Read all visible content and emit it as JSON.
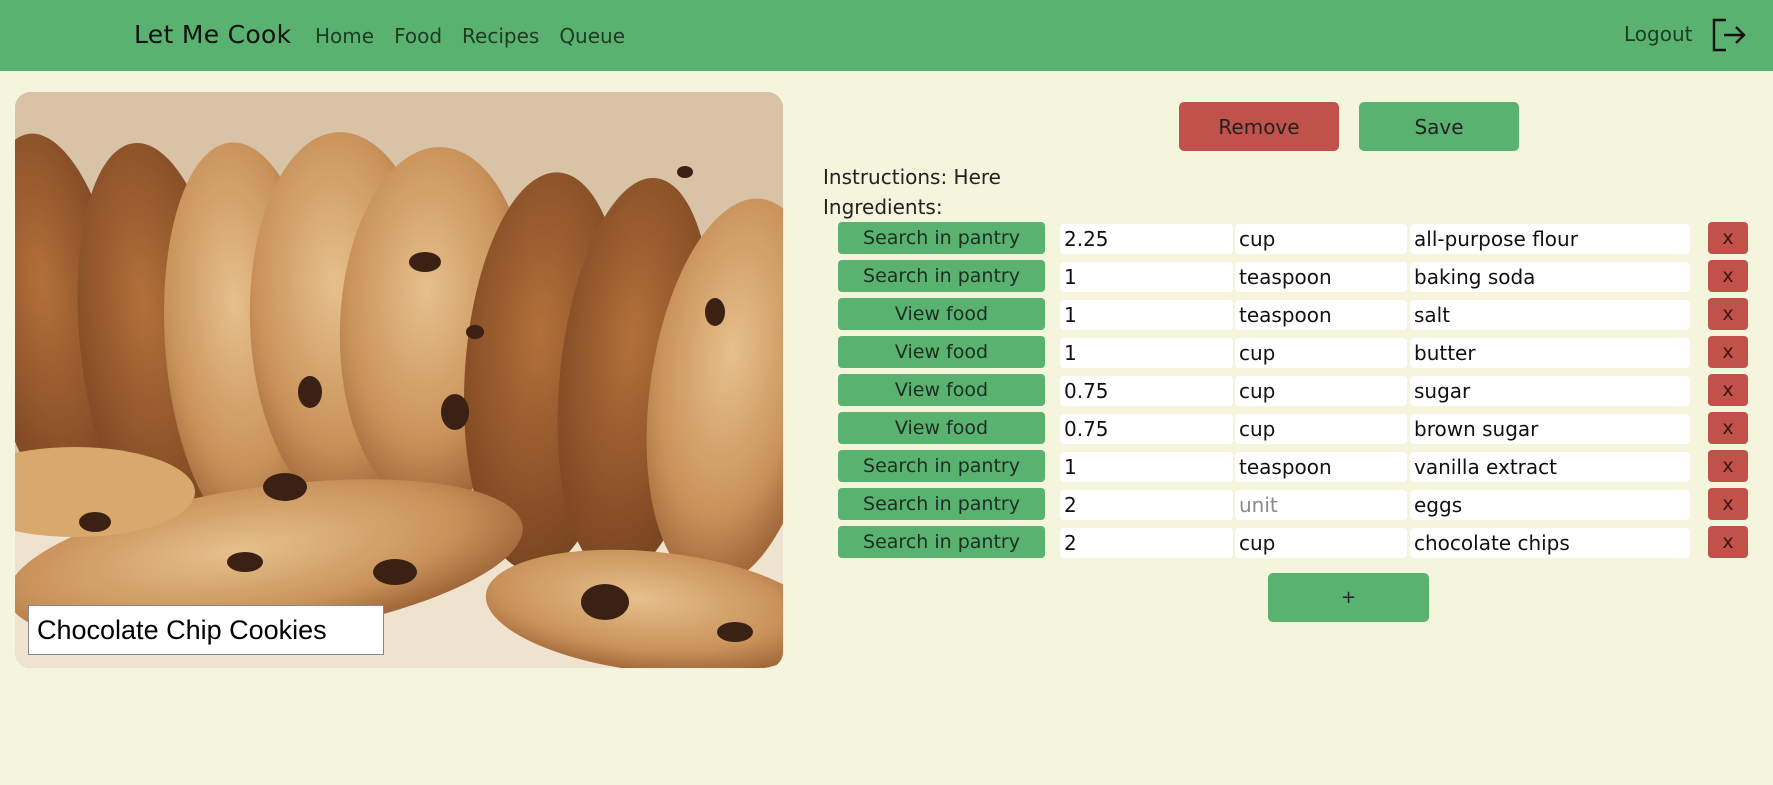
{
  "navbar": {
    "brand": "Let Me Cook",
    "links": [
      "Home",
      "Food",
      "Recipes",
      "Queue"
    ],
    "logout_label": "Logout",
    "background": "#59b26f"
  },
  "recipe": {
    "title": "Chocolate Chip Cookies",
    "image_alt": "cookies-photo",
    "instructions_label": "Instructions: Here",
    "ingredients_label": "Ingredients:"
  },
  "actions": {
    "remove_label": "Remove",
    "save_label": "Save",
    "add_label": "+"
  },
  "ingredients": [
    {
      "action": "Search in pantry",
      "quantity": "2.25",
      "unit": "cup",
      "name": "all-purpose flour",
      "delete": "x"
    },
    {
      "action": "Search in pantry",
      "quantity": "1",
      "unit": "teaspoon",
      "name": "baking soda",
      "delete": "x"
    },
    {
      "action": "View food",
      "quantity": "1",
      "unit": "teaspoon",
      "name": "salt",
      "delete": "x"
    },
    {
      "action": "View food",
      "quantity": "1",
      "unit": "cup",
      "name": "butter",
      "delete": "x"
    },
    {
      "action": "View food",
      "quantity": "0.75",
      "unit": "cup",
      "name": "sugar",
      "delete": "x"
    },
    {
      "action": "View food",
      "quantity": "0.75",
      "unit": "cup",
      "name": "brown sugar",
      "delete": "x"
    },
    {
      "action": "Search in pantry",
      "quantity": "1",
      "unit": "teaspoon",
      "name": "vanilla extract",
      "delete": "x"
    },
    {
      "action": "Search in pantry",
      "quantity": "2",
      "unit_placeholder": "unit",
      "name": "eggs",
      "delete": "x"
    },
    {
      "action": "Search in pantry",
      "quantity": "2",
      "unit": "cup",
      "name": "chocolate chips",
      "delete": "x"
    }
  ],
  "colors": {
    "page_bg": "#f5f4dc",
    "accent_green": "#59b26f",
    "danger_red": "#c1524a"
  }
}
